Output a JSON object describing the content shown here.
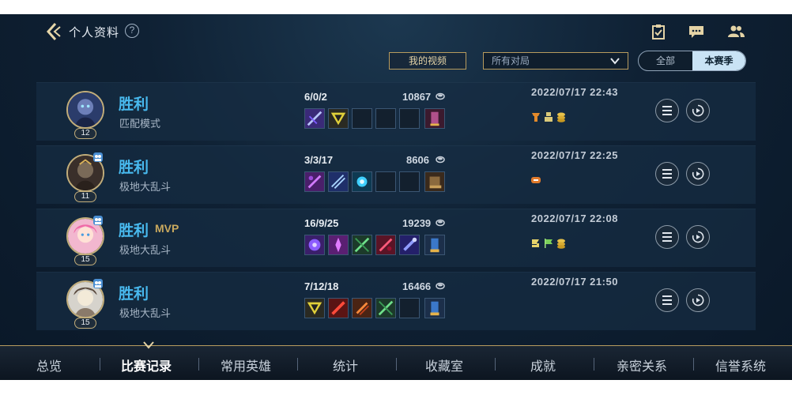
{
  "header": {
    "title": "个人资料",
    "help_icon": "question-circle-icon",
    "right_icons": [
      "checklist-icon",
      "chat-icon",
      "friends-icon"
    ]
  },
  "controls": {
    "my_video_label": "我的视频",
    "filter": {
      "selected": "所有对局"
    },
    "season_toggle": {
      "options": [
        "全部",
        "本赛季"
      ],
      "selected": "本赛季"
    }
  },
  "matches": [
    {
      "result": "胜利",
      "mvp": "",
      "mode": "匹配模式",
      "level": "12",
      "kda": "6/0/2",
      "gold": "10867",
      "datetime": "2022/07/17 22:43",
      "party": false
    },
    {
      "result": "胜利",
      "mvp": "",
      "mode": "极地大乱斗",
      "level": "11",
      "kda": "3/3/17",
      "gold": "8606",
      "datetime": "2022/07/17 22:25",
      "party": true
    },
    {
      "result": "胜利",
      "mvp": "MVP",
      "mode": "极地大乱斗",
      "level": "15",
      "kda": "16/9/25",
      "gold": "19239",
      "datetime": "2022/07/17 22:08",
      "party": true
    },
    {
      "result": "胜利",
      "mvp": "",
      "mode": "极地大乱斗",
      "level": "15",
      "kda": "7/12/18",
      "gold": "16466",
      "datetime": "2022/07/17 21:50",
      "party": true
    }
  ],
  "nav": {
    "tabs": [
      "总览",
      "比赛记录",
      "常用英雄",
      "统计",
      "收藏室",
      "成就",
      "亲密关系",
      "信誉系统"
    ],
    "active": "比赛记录"
  },
  "colors": {
    "accent_gold": "#b79b5e",
    "win_blue": "#48b9ee",
    "mvp_gold": "#c9a95e"
  }
}
